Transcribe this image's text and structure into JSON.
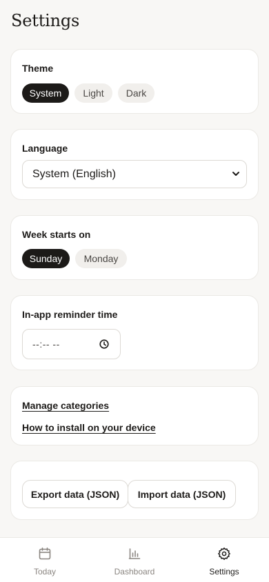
{
  "header": {
    "title": "Settings"
  },
  "theme": {
    "label": "Theme",
    "options": [
      "System",
      "Light",
      "Dark"
    ],
    "selected": "System"
  },
  "language": {
    "label": "Language",
    "value": "System (English)"
  },
  "week": {
    "label": "Week starts on",
    "options": [
      "Sunday",
      "Monday"
    ],
    "selected": "Sunday"
  },
  "reminder": {
    "label": "In-app reminder time",
    "value": "--:-- --"
  },
  "links": {
    "manage_categories": "Manage categories",
    "install": "How to install on your device"
  },
  "data": {
    "export_label": "Export data (JSON)",
    "import_label": "Import data (JSON)"
  },
  "tabbar": {
    "tabs": [
      {
        "label": "Today",
        "icon": "calendar-icon"
      },
      {
        "label": "Dashboard",
        "icon": "bar-chart-icon"
      },
      {
        "label": "Settings",
        "icon": "gear-icon"
      }
    ],
    "active": "Settings"
  },
  "colors": {
    "background": "#f8f7f5",
    "card": "#ffffff",
    "accent": "#1c1a18",
    "pill_inactive": "#f1efec",
    "muted_text": "#8a8580"
  }
}
